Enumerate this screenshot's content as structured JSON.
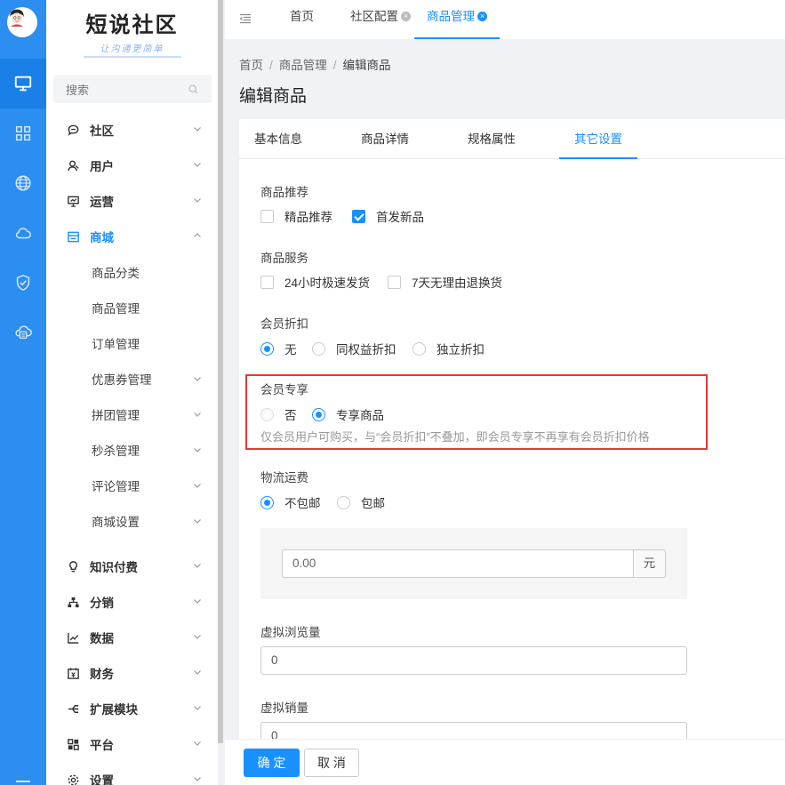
{
  "app": {
    "logo_title": "短说社区",
    "logo_subtitle": "让沟通更简单"
  },
  "sidebar": {
    "search_placeholder": "搜索",
    "menu": [
      {
        "label": "社区",
        "icon": "chat-icon"
      },
      {
        "label": "用户",
        "icon": "user-icon"
      },
      {
        "label": "运营",
        "icon": "presentation-icon"
      },
      {
        "label": "商城",
        "icon": "store-icon",
        "expanded": true
      },
      {
        "label": "知识付费",
        "icon": "bulb-icon"
      },
      {
        "label": "分销",
        "icon": "network-icon"
      },
      {
        "label": "数据",
        "icon": "line-chart-icon"
      },
      {
        "label": "财务",
        "icon": "finance-icon"
      },
      {
        "label": "扩展模块",
        "icon": "branch-icon"
      },
      {
        "label": "平台",
        "icon": "platform-icon"
      },
      {
        "label": "设置",
        "icon": "gear-icon"
      }
    ],
    "mall_submenu": [
      "商品分类",
      "商品管理",
      "订单管理",
      "优惠券管理",
      "拼团管理",
      "秒杀管理",
      "评论管理",
      "商城设置"
    ]
  },
  "top_tabs": [
    {
      "label": "首页"
    },
    {
      "label": "社区配置"
    },
    {
      "label": "商品管理",
      "active": true
    }
  ],
  "breadcrumb": [
    "首页",
    "商品管理",
    "编辑商品"
  ],
  "page_title": "编辑商品",
  "form_tabs": [
    "基本信息",
    "商品详情",
    "规格属性",
    "其它设置"
  ],
  "form": {
    "recommend": {
      "label": "商品推荐",
      "options": [
        {
          "label": "精品推荐",
          "checked": false
        },
        {
          "label": "首发新品",
          "checked": true
        }
      ]
    },
    "service": {
      "label": "商品服务",
      "options": [
        {
          "label": "24小时极速发货",
          "checked": false
        },
        {
          "label": "7天无理由退换货",
          "checked": false
        }
      ]
    },
    "member_discount": {
      "label": "会员折扣",
      "options": [
        {
          "label": "无",
          "checked": true
        },
        {
          "label": "同权益折扣",
          "checked": false
        },
        {
          "label": "独立折扣",
          "checked": false
        }
      ]
    },
    "member_exclusive": {
      "label": "会员专享",
      "options": [
        {
          "label": "否",
          "checked": false
        },
        {
          "label": "专享商品",
          "checked": true
        }
      ],
      "hint": "仅会员用户可购买，与“会员折扣”不叠加，即会员专享不再享有会员折扣价格"
    },
    "shipping": {
      "label": "物流运费",
      "options": [
        {
          "label": "不包邮",
          "checked": true
        },
        {
          "label": "包邮",
          "checked": false
        }
      ],
      "fee_value": "0.00",
      "fee_unit": "元"
    },
    "virtual_views": {
      "label": "虚拟浏览量",
      "value": "0"
    },
    "virtual_sales": {
      "label": "虚拟销量",
      "value": "0"
    }
  },
  "actions": {
    "confirm": "确 定",
    "cancel": "取 消"
  },
  "colors": {
    "rail": "#2b8ef0",
    "primary": "#1890ff",
    "highlight": "#e53935"
  }
}
